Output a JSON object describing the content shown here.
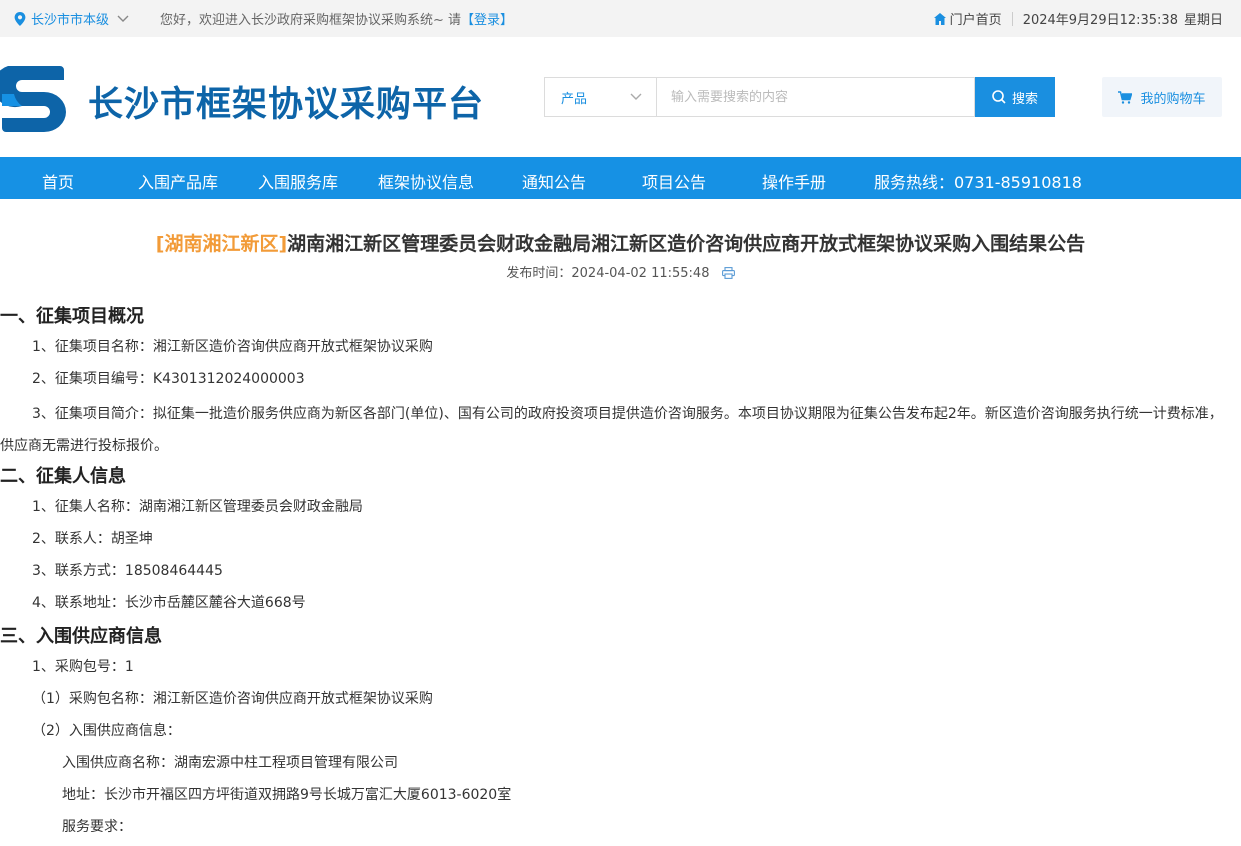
{
  "topbar": {
    "location": "长沙市市本级",
    "welcome": "您好，欢迎进入长沙政府采购框架协议采购系统~ 请",
    "login_label": "【登录】",
    "portal_label": "门户首页",
    "date": "2024年9月29日12:35:38",
    "weekday": "星期日"
  },
  "header": {
    "site_title": "长沙市框架协议采购平台",
    "search_category": "产品",
    "search_placeholder": "输入需要搜索的内容",
    "search_button": "搜索",
    "cart_label": "我的购物车"
  },
  "nav": {
    "items": [
      "首页",
      "入围产品库",
      "入围服务库",
      "框架协议信息",
      "通知公告",
      "项目公告",
      "操作手册"
    ],
    "hotline": "服务热线：0731-85910818"
  },
  "article": {
    "region_tag": "[湖南湘江新区]",
    "title": "湖南湘江新区管理委员会财政金融局湘江新区造价咨询供应商开放式框架协议采购入围结果公告",
    "publish_label": "发布时间：",
    "publish_time": "2024-04-02 11:55:48",
    "section1": {
      "heading": "一、征集项目概况",
      "name": "1、征集项目名称：湘江新区造价咨询供应商开放式框架协议采购",
      "code": "2、征集项目编号：K4301312024000003",
      "intro": "3、征集项目简介：拟征集一批造价服务供应商为新区各部门(单位)、国有公司的政府投资项目提供造价咨询服务。本项目协议期限为征集公告发布起2年。新区造价咨询服务执行统一计费标准，供应商无需进行投标报价。"
    },
    "section2": {
      "heading": "二、征集人信息",
      "name": "1、征集人名称：湖南湘江新区管理委员会财政金融局",
      "contact": "2、联系人：胡圣坤",
      "phone": "3、联系方式：18508464445",
      "address": "4、联系地址：长沙市岳麓区麓谷大道668号"
    },
    "section3": {
      "heading": "三、入围供应商信息",
      "package_no": "1、采购包号：1",
      "package_name": "（1）采购包名称：湘江新区造价咨询供应商开放式框架协议采购",
      "supplier_info": "（2）入围供应商信息：",
      "supplier_name": "入围供应商名称：湖南宏源中柱工程项目管理有限公司",
      "supplier_address": "地址：长沙市开福区四方坪街道双拥路9号长城万富汇大厦6013-6020室",
      "service_req": "服务要求："
    }
  }
}
